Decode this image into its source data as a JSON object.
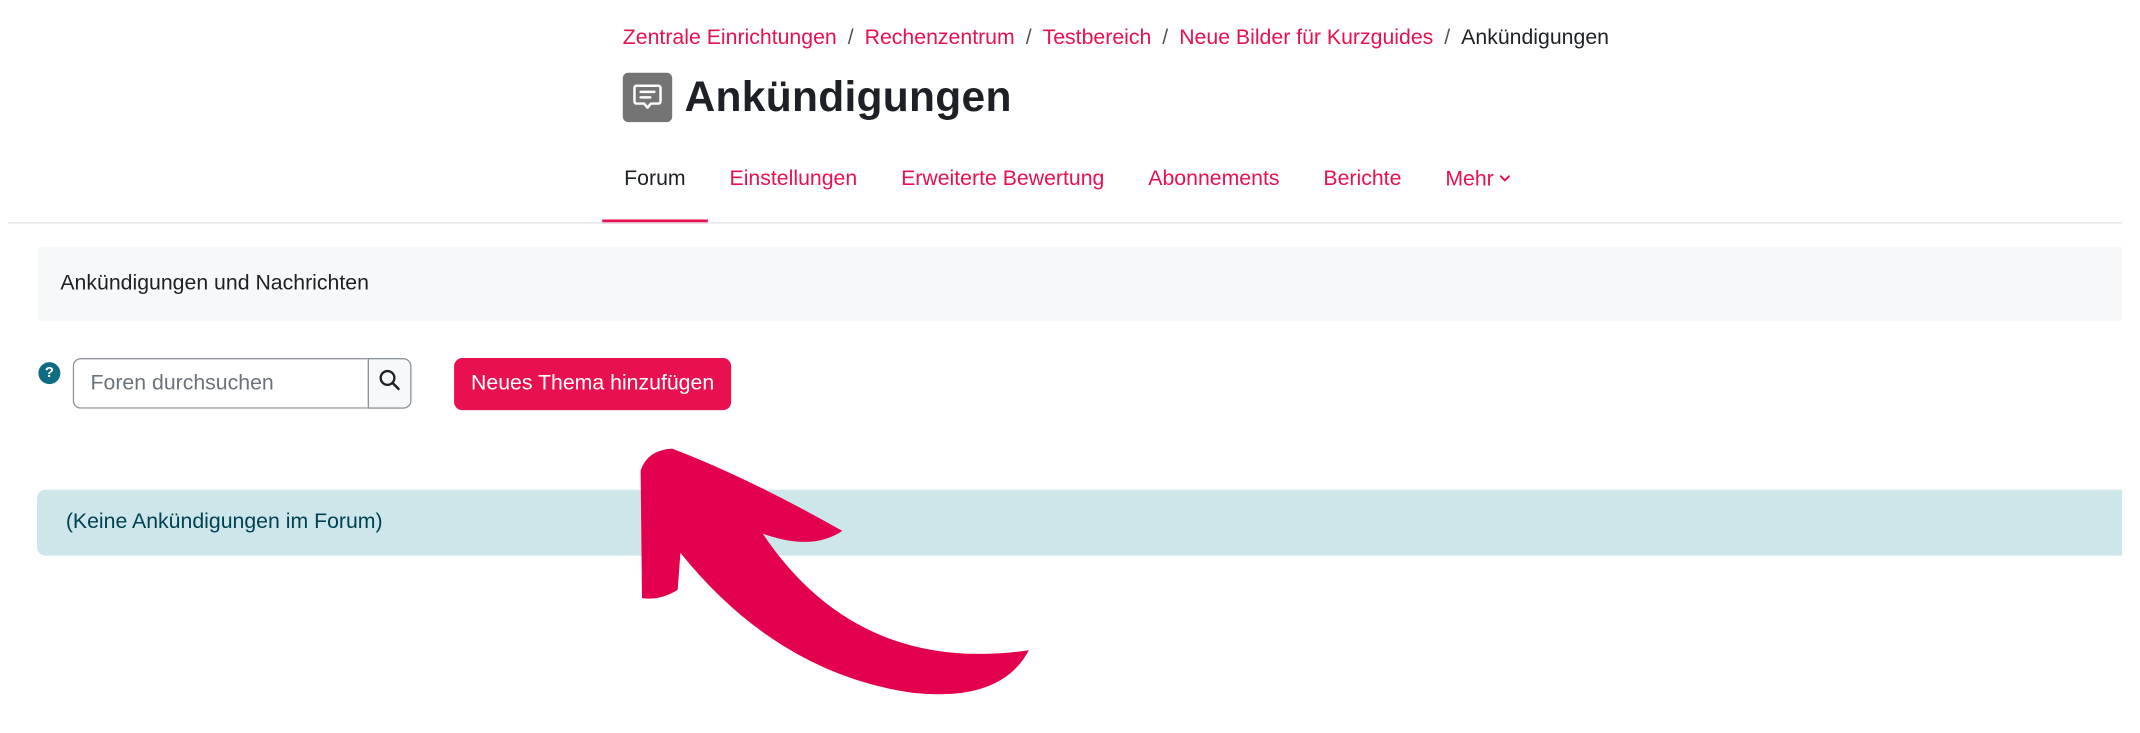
{
  "breadcrumb": {
    "items": [
      "Zentrale Einrichtungen",
      "Rechenzentrum",
      "Testbereich",
      "Neue Bilder für Kurzguides"
    ],
    "separator": "/",
    "current": "Ankündigungen"
  },
  "header": {
    "icon": "forum-icon",
    "title": "Ankündigungen"
  },
  "tabs": [
    {
      "label": "Forum",
      "active": true
    },
    {
      "label": "Einstellungen"
    },
    {
      "label": "Erweiterte Bewertung"
    },
    {
      "label": "Abonnements"
    },
    {
      "label": "Berichte"
    },
    {
      "label": "Mehr",
      "icon": "chevron-down-icon"
    }
  ],
  "intro": {
    "text": "Ankündigungen und Nachrichten"
  },
  "search": {
    "help_icon": "question-mark-icon",
    "help_symbol": "?",
    "placeholder": "Foren durchsuchen",
    "button_icon": "search-icon"
  },
  "actions": {
    "add_topic_label": "Neues Thema hinzufügen"
  },
  "notice": {
    "text": "(Keine Ankündigungen im Forum)"
  },
  "annotation": {
    "arrow_icon": "curved-arrow-icon",
    "color": "#e2004f"
  },
  "colors": {
    "accent": "#e8104f",
    "info_background": "#cce6ea",
    "info_text": "#004252",
    "help_icon": "#0f6c84"
  }
}
